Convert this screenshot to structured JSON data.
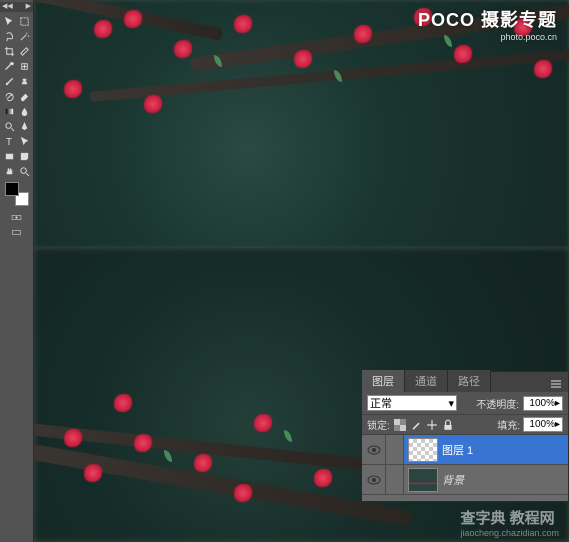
{
  "toolbar": {
    "collapse_left": "◀◀",
    "collapse_right": "▶",
    "tools": [
      {
        "name": "move-tool"
      },
      {
        "name": "marquee-tool"
      },
      {
        "name": "lasso-tool"
      },
      {
        "name": "magic-wand-tool"
      },
      {
        "name": "crop-tool"
      },
      {
        "name": "slice-tool"
      },
      {
        "name": "eyedropper-tool"
      },
      {
        "name": "healing-brush-tool"
      },
      {
        "name": "brush-tool"
      },
      {
        "name": "clone-stamp-tool"
      },
      {
        "name": "history-brush-tool"
      },
      {
        "name": "eraser-tool"
      },
      {
        "name": "gradient-tool"
      },
      {
        "name": "blur-tool"
      },
      {
        "name": "dodge-tool"
      },
      {
        "name": "pen-tool"
      },
      {
        "name": "type-tool"
      },
      {
        "name": "path-selection-tool"
      },
      {
        "name": "rectangle-tool"
      },
      {
        "name": "notes-tool"
      },
      {
        "name": "hand-tool"
      },
      {
        "name": "zoom-tool"
      }
    ],
    "swatch_fg": "#000000",
    "swatch_bg": "#ffffff"
  },
  "watermark": {
    "brand": "POCO 摄影专题",
    "url": "photo.poco.cn",
    "site": "查字典 教程网",
    "site_sub": "jiaocheng.chazidian.com"
  },
  "layers_panel": {
    "tabs": {
      "layers": "图层",
      "channels": "通道",
      "paths": "路径"
    },
    "blend_mode": "正常",
    "opacity_label": "不透明度:",
    "opacity_value": "100%",
    "lock_label": "锁定:",
    "fill_label": "填充:",
    "fill_value": "100%",
    "layers": [
      {
        "name": "图层 1",
        "visible": true,
        "selected": true,
        "thumb": "checker"
      },
      {
        "name": "背景",
        "visible": true,
        "selected": false,
        "thumb": "photo"
      }
    ]
  }
}
